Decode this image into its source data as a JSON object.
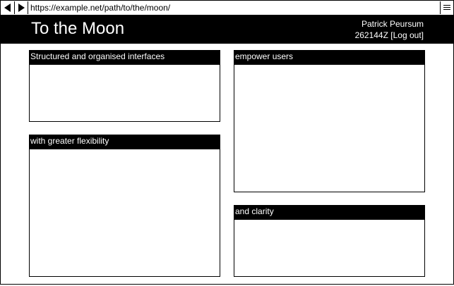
{
  "browser": {
    "url": "https://example.net/path/to/the/moon/",
    "back_icon": "back-arrow-icon",
    "forward_icon": "forward-arrow-icon",
    "menu_icon": "hamburger-menu-icon"
  },
  "header": {
    "title": "To the Moon",
    "user_name": "Patrick Peursum",
    "user_id": "262144Z",
    "logout_label": "[Log out]"
  },
  "panels": [
    {
      "title": "Structured and organised interfaces"
    },
    {
      "title": "with greater flexibility"
    },
    {
      "title": "empower users"
    },
    {
      "title": "and clarity"
    }
  ],
  "colors": {
    "header_bg": "#000000",
    "header_fg": "#ffffff",
    "page_bg": "#ffffff",
    "border": "#000000"
  }
}
